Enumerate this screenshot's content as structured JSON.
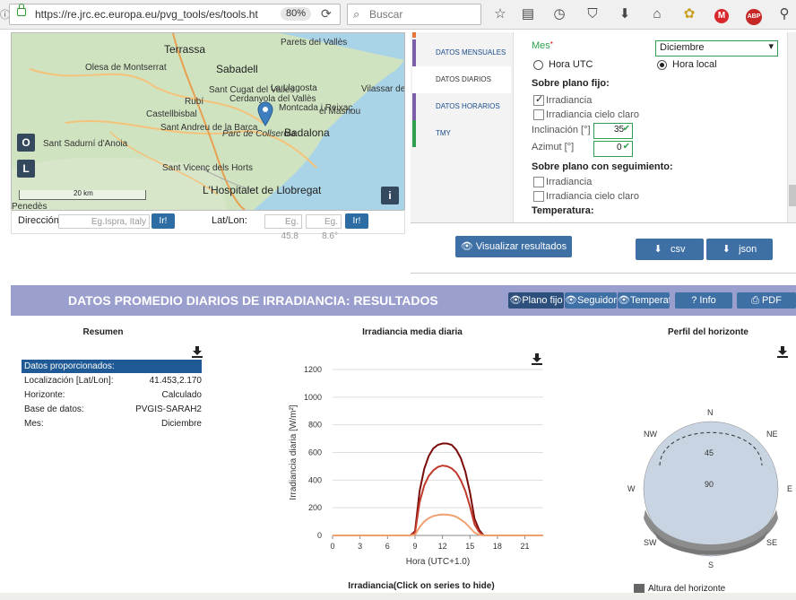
{
  "browser": {
    "url": "https://re.jrc.ec.europa.eu/pvg_tools/es/tools.ht",
    "zoom": "80%",
    "search_placeholder": "Buscar"
  },
  "map": {
    "labels": [
      "Terrassa",
      "Sabadell",
      "Olesa de Montserrat",
      "Parets del Vallès",
      "Sant Cugat del Vallès",
      "Rubí",
      "Cerdanyola del Vallès",
      "La Llagosta",
      "Castellbisbal",
      "Montcada i Reixac",
      "Vilassar de Mar",
      "Sant Andreu de la Barca",
      "Badalona",
      "Sant Sadurní d'Anoia",
      "Parc de Collserola",
      "Sant Vicenç dels Horts",
      "L'Hospitalet de Llobregat",
      "el Masnou",
      "Penedès"
    ],
    "scale": "20 km",
    "btn_o": "O",
    "btn_l": "L",
    "btn_info": "i"
  },
  "address": {
    "label": "Dirección",
    "placeholder": "Eg.Ispra, Italy",
    "go": "Ir!",
    "latlon_label": "Lat/Lon:",
    "lat_placeholder": "Eg. 45.8",
    "lon_placeholder": "Eg. 8.6°",
    "go2": "Ir!"
  },
  "tabs": [
    "DATOS MENSUALES",
    "DATOS DIARIOS",
    "DATOS HORARIOS",
    "TMY"
  ],
  "form": {
    "mes_label": "Mes",
    "mes_value": "Diciembre",
    "hora_utc": "Hora UTC",
    "hora_local": "Hora local",
    "fixed_title": "Sobre plano fijo:",
    "irradiancia": "Irradiancia",
    "irr_cielo": "Irradiancia cielo claro",
    "inclinacion": "Inclinación [°]",
    "inclinacion_value": "35",
    "azimut": "Azimut [°]",
    "azimut_value": "0",
    "tracking_title": "Sobre plano con seguimiento:",
    "irradiancia2": "Irradiancia",
    "irr_cielo2": "Irradiancia cielo claro",
    "temp_title": "Temperatura:"
  },
  "buttons": {
    "visualizar": "Visualizar resultados",
    "csv": "csv",
    "json": "json"
  },
  "results": {
    "title": "DATOS PROMEDIO DIARIOS DE IRRADIANCIA: RESULTADOS",
    "btn_plano": "Plano fijo",
    "btn_seguidor": "Seguidor",
    "btn_temp": "Temperat",
    "btn_info": "Info",
    "btn_pdf": "PDF"
  },
  "summary": {
    "title": "Resumen",
    "header": "Datos proporcionados:",
    "rows": [
      {
        "k": "Localización [Lat/Lon]:",
        "v": "41.453,2.170"
      },
      {
        "k": "Horizonte:",
        "v": "Calculado"
      },
      {
        "k": "Base de datos:",
        "v": "PVGIS-SARAH2"
      },
      {
        "k": "Mes:",
        "v": "Diciembre"
      }
    ]
  },
  "chart_title": "Irradiancia media diaria",
  "chart_legend_title": "Irradiancia(Click on series to hide)",
  "chart_data": [
    {
      "type": "line",
      "title": "Irradiancia media diaria",
      "xlabel": "Hora (UTC+1.0)",
      "ylabel": "Irradiancia diaria [W/m²]",
      "xlim": [
        0,
        23
      ],
      "ylim": [
        0,
        1200
      ],
      "xticks": [
        0,
        3,
        6,
        9,
        12,
        15,
        18,
        21
      ],
      "yticks": [
        0,
        200,
        400,
        600,
        800,
        1000,
        1200
      ],
      "grid": true,
      "x": [
        0,
        1,
        2,
        3,
        4,
        5,
        6,
        7,
        8,
        8.5,
        9,
        9.5,
        10,
        10.5,
        11,
        11.5,
        12,
        12.5,
        13,
        13.5,
        14,
        14.5,
        15,
        15.5,
        16,
        16.5,
        17,
        18,
        19,
        20,
        21,
        22,
        23
      ],
      "series": [
        {
          "color": "#7a0b0b",
          "values": [
            0,
            0,
            0,
            0,
            0,
            0,
            0,
            0,
            0,
            0,
            30,
            320,
            480,
            575,
            630,
            655,
            665,
            665,
            655,
            620,
            560,
            460,
            310,
            120,
            40,
            0,
            0,
            0,
            0,
            0,
            0,
            0,
            0
          ]
        },
        {
          "color": "#c0392b",
          "values": [
            0,
            0,
            0,
            0,
            0,
            0,
            0,
            0,
            0,
            0,
            20,
            240,
            360,
            430,
            470,
            495,
            505,
            500,
            485,
            455,
            400,
            320,
            210,
            80,
            25,
            0,
            0,
            0,
            0,
            0,
            0,
            0,
            0
          ]
        },
        {
          "color": "#f0a070",
          "values": [
            0,
            0,
            0,
            0,
            0,
            0,
            0,
            0,
            0,
            0,
            5,
            60,
            100,
            125,
            140,
            148,
            152,
            150,
            145,
            135,
            115,
            90,
            55,
            20,
            5,
            0,
            0,
            0,
            0,
            0,
            0,
            0,
            0
          ]
        }
      ]
    }
  ],
  "horizon": {
    "title": "Perfil del horizonte",
    "dirs": [
      "N",
      "NE",
      "E",
      "SE",
      "S",
      "SW",
      "W",
      "NW"
    ],
    "rings": [
      "45",
      "90"
    ],
    "legend": "Altura del horizonte"
  },
  "colors": {
    "accent": "#3e6fa5",
    "results_bar": "#9b9fce",
    "summary_header": "#1f5a96"
  }
}
